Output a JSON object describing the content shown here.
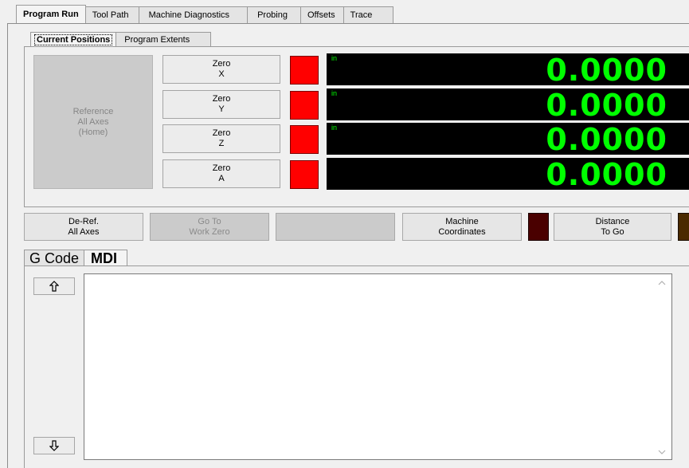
{
  "top_tabs": [
    "Program Run",
    "Tool Path",
    "Machine Diagnostics",
    "Probing",
    "Offsets",
    "Trace"
  ],
  "sub_tabs": [
    "Current Positions",
    "Program Extents"
  ],
  "reference": {
    "line1": "Reference",
    "line2": "All Axes",
    "line3": "(Home)"
  },
  "axes": [
    {
      "zero_label": "Zero",
      "axis": "X",
      "unit": "in",
      "value": "0.0000",
      "led_color": "#ff0000"
    },
    {
      "zero_label": "Zero",
      "axis": "Y",
      "unit": "in",
      "value": "0.0000",
      "led_color": "#ff0000"
    },
    {
      "zero_label": "Zero",
      "axis": "Z",
      "unit": "in",
      "value": "0.0000",
      "led_color": "#ff0000"
    },
    {
      "zero_label": "Zero",
      "axis": "A",
      "unit": "",
      "value": "0.0000",
      "led_color": "#ff0000"
    }
  ],
  "bottom_bar": {
    "deref": {
      "line1": "De-Ref.",
      "line2": "All Axes"
    },
    "goto": {
      "line1": "Go To",
      "line2": "Work Zero"
    },
    "blank": "",
    "machine": {
      "line1": "Machine",
      "line2": "Coordinates"
    },
    "machine_led_color": "#4a0000",
    "distance": {
      "line1": "Distance",
      "line2": "To Go"
    },
    "distance_led_color": "#4a2a00"
  },
  "lower_tabs": [
    "G Code",
    "MDI"
  ],
  "mdi": {
    "text": ""
  },
  "colors": {
    "dro_text": "#00ff00",
    "dro_bg": "#000000"
  },
  "icons": {
    "up": "arrow-up-icon",
    "down": "arrow-down-icon"
  }
}
